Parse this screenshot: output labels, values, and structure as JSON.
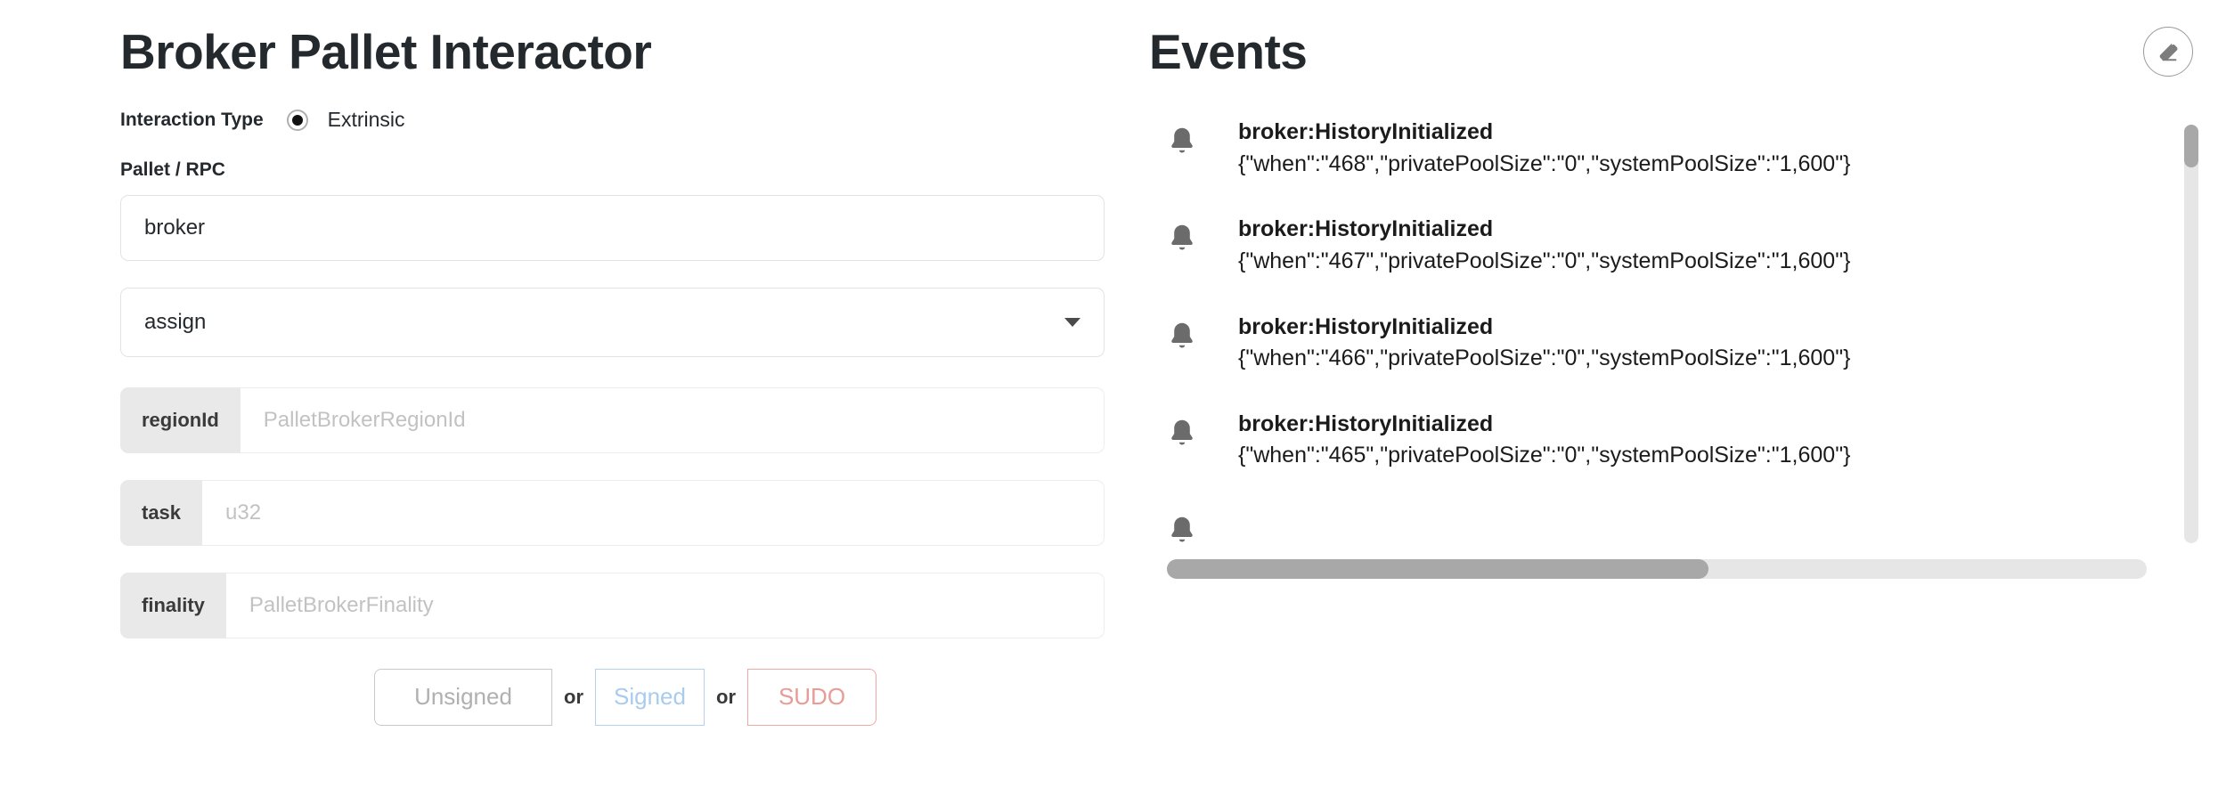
{
  "interactor": {
    "title": "Broker Pallet Interactor",
    "interaction_type_label": "Interaction Type",
    "interaction_type_value": "Extrinsic",
    "pallet_rpc_label": "Pallet / RPC",
    "pallet_value": "broker",
    "call_value": "assign",
    "params": [
      {
        "name": "regionId",
        "placeholder": "PalletBrokerRegionId",
        "value": ""
      },
      {
        "name": "task",
        "placeholder": "u32",
        "value": ""
      },
      {
        "name": "finality",
        "placeholder": "PalletBrokerFinality",
        "value": ""
      }
    ],
    "submit": {
      "unsigned_label": "Unsigned",
      "or_label_1": "or",
      "signed_label": "Signed",
      "or_label_2": "or",
      "sudo_label": "SUDO"
    }
  },
  "events": {
    "title": "Events",
    "clear_button_label": "",
    "items": [
      {
        "name": "broker:HistoryInitialized",
        "payload": "{\"when\":\"468\",\"privatePoolSize\":\"0\",\"systemPoolSize\":\"1,600\"}"
      },
      {
        "name": "broker:HistoryInitialized",
        "payload": "{\"when\":\"467\",\"privatePoolSize\":\"0\",\"systemPoolSize\":\"1,600\"}"
      },
      {
        "name": "broker:HistoryInitialized",
        "payload": "{\"when\":\"466\",\"privatePoolSize\":\"0\",\"systemPoolSize\":\"1,600\"}"
      },
      {
        "name": "broker:HistoryInitialized",
        "payload": "{\"when\":\"465\",\"privatePoolSize\":\"0\",\"systemPoolSize\":\"1,600\"}"
      }
    ]
  },
  "colors": {
    "text": "#24292e",
    "muted": "#c2c2c2",
    "signed": "#a9cbee",
    "sudo": "#e99b95",
    "chip_bg": "#e9e9e9",
    "scrollbar": "#a8a8a8"
  }
}
